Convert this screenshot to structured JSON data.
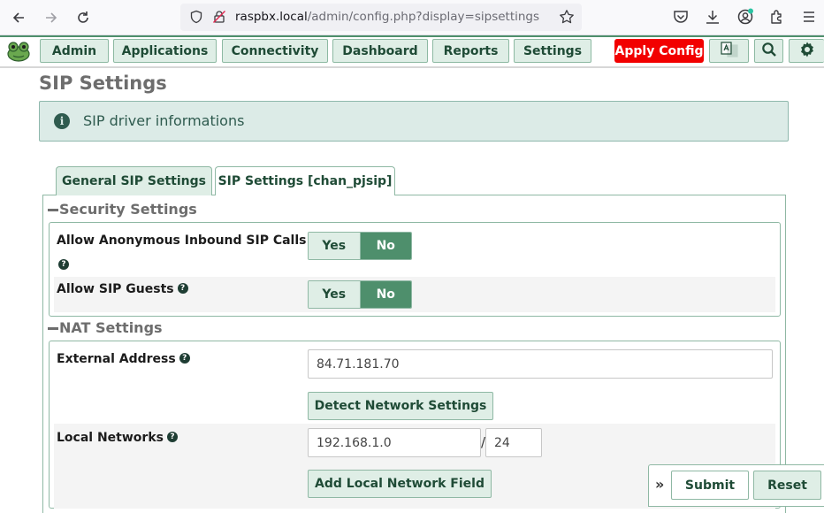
{
  "browser": {
    "url_host": "raspbx.local",
    "url_path": "/admin/config.php?display=sipsettings"
  },
  "nav": {
    "items": [
      "Admin",
      "Applications",
      "Connectivity",
      "Dashboard",
      "Reports",
      "Settings"
    ],
    "apply_label": "Apply Config"
  },
  "page": {
    "title": "SIP Settings",
    "alert": "SIP driver informations",
    "tabs": [
      "General SIP Settings",
      "SIP Settings [chan_pjsip]"
    ]
  },
  "security": {
    "legend": "Security Settings",
    "anon_label": "Allow Anonymous Inbound SIP Calls",
    "guests_label": "Allow SIP Guests",
    "yes": "Yes",
    "no": "No"
  },
  "nat": {
    "legend": "NAT Settings",
    "external_label": "External Address",
    "external_value": "84.71.181.70",
    "detect_label": "Detect Network Settings",
    "local_label": "Local Networks",
    "local_ip": "192.168.1.0",
    "slash": "/",
    "local_mask": "24",
    "add_label": "Add Local Network Field"
  },
  "actions": {
    "chevron": "»",
    "submit": "Submit",
    "reset": "Reset"
  },
  "colors": {
    "accent": "#4e8f6c",
    "apply": "#f20000"
  }
}
